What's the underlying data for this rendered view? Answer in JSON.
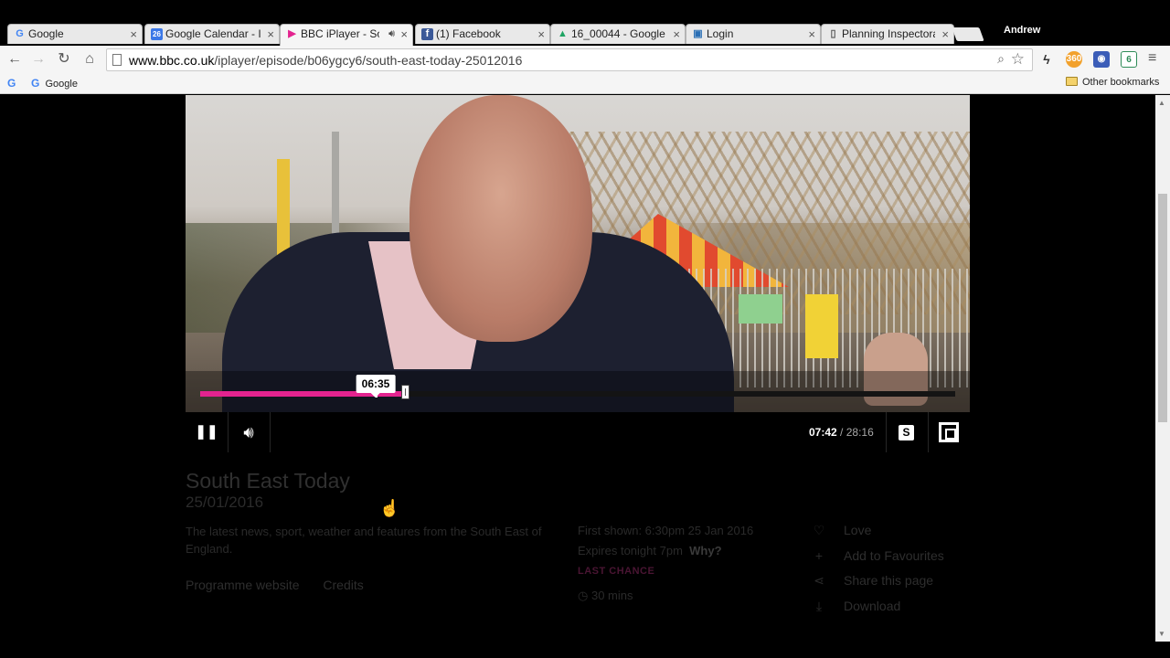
{
  "browser": {
    "tabs": [
      {
        "label": "Google",
        "favicon": "G",
        "favicon_color": "#4285f4",
        "favicon_bg": "transparent"
      },
      {
        "label": "Google Calendar - I",
        "favicon": "26",
        "favicon_color": "#ffffff",
        "favicon_bg": "#3b78e7"
      },
      {
        "label": "BBC iPlayer - Sou",
        "favicon": "▶",
        "favicon_color": "#e3238f",
        "favicon_bg": "transparent",
        "active": true,
        "audio": true
      },
      {
        "label": "(1) Facebook",
        "favicon": "f",
        "favicon_color": "#ffffff",
        "favicon_bg": "#3b5998"
      },
      {
        "label": "16_00044 - Google",
        "favicon": "▲",
        "favicon_color": "#1fa463",
        "favicon_bg": "transparent"
      },
      {
        "label": "Login",
        "favicon": "▣",
        "favicon_color": "#2a6fb5",
        "favicon_bg": "transparent"
      },
      {
        "label": "Planning Inspectora",
        "favicon": "▯",
        "favicon_color": "#555555",
        "favicon_bg": "transparent"
      }
    ],
    "profile_name": "Andrew",
    "url_host": "www.bbc.co.uk",
    "url_path": "/iplayer/episode/b06ygcy6/south-east-today-25012016",
    "bookmarks": {
      "google_label": "Google",
      "other_label": "Other bookmarks"
    }
  },
  "player": {
    "progress_fraction": 0.271,
    "hover_fraction": 0.233,
    "hover_time": "06:35",
    "current_time": "07:42",
    "total_time": "/ 28:16",
    "subtitles_label": "S",
    "accent_color": "#e3238f"
  },
  "programme": {
    "title": "South East Today",
    "date": "25/01/2016",
    "description": "The latest news, sport, weather and features from the South East of England.",
    "links": [
      "Programme website",
      "Credits"
    ],
    "first_shown": "First shown: 6:30pm 25 Jan 2016",
    "expires": "Expires tonight 7pm",
    "why": "Why?",
    "last_chance": "LAST CHANCE",
    "duration": "30 mins",
    "actions": [
      {
        "label": "Love",
        "icon": "heart-icon",
        "glyph": "♡"
      },
      {
        "label": "Add to Favourites",
        "icon": "plus-icon",
        "glyph": "+"
      },
      {
        "label": "Share this page",
        "icon": "share-icon",
        "glyph": "⋖"
      },
      {
        "label": "Download",
        "icon": "download-icon",
        "glyph": "⤓"
      }
    ]
  }
}
